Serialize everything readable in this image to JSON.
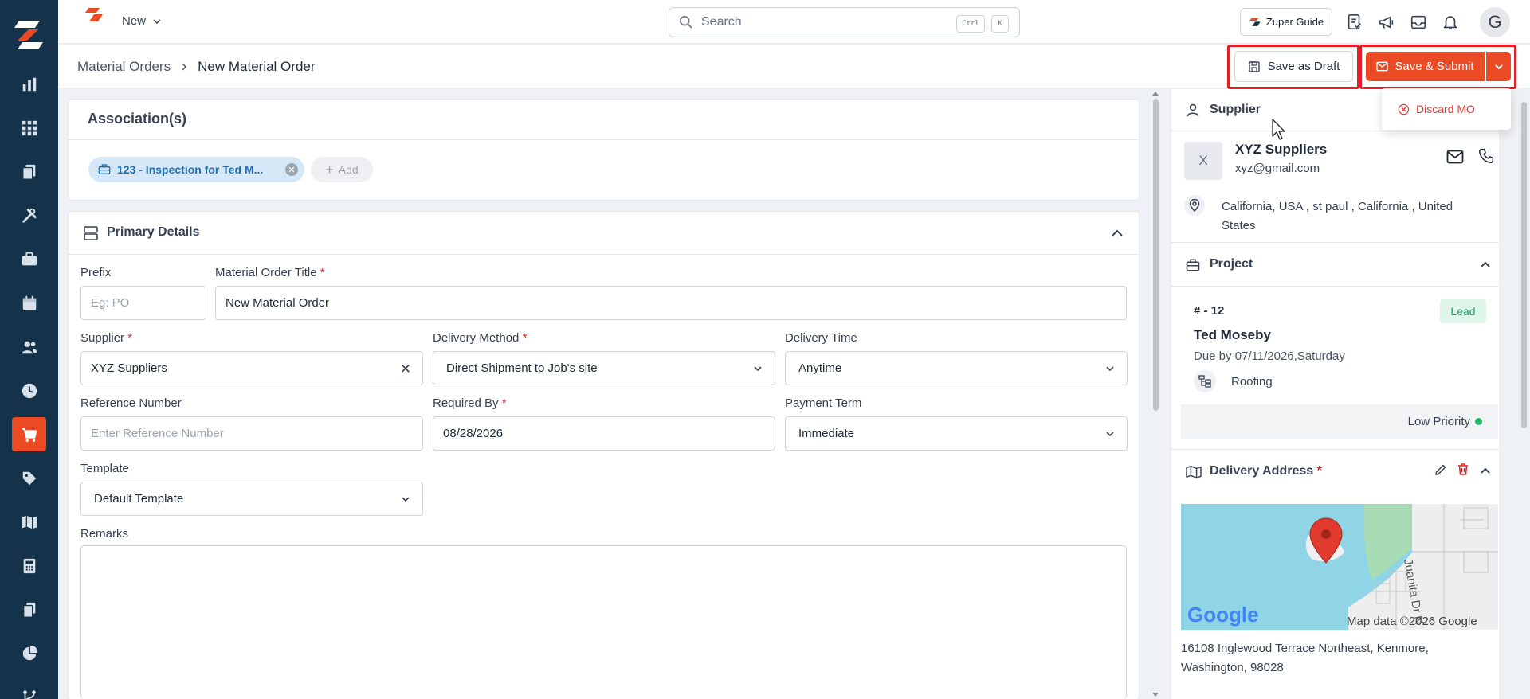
{
  "topbar": {
    "new_label": "New",
    "search_placeholder": "Search",
    "shortcut_key1": "Ctrl",
    "shortcut_key2": "K",
    "guide_label": "Zuper Guide",
    "avatar_initial": "G"
  },
  "breadcrumb": {
    "parent": "Material Orders",
    "current": "New Material Order"
  },
  "actions": {
    "save_draft": "Save as Draft",
    "save_submit": "Save & Submit",
    "discard": "Discard MO"
  },
  "associations": {
    "title": "Association(s)",
    "chip_label": "123 - Inspection for Ted M...",
    "add_label": "Add"
  },
  "primary": {
    "title": "Primary Details",
    "prefix_label": "Prefix",
    "prefix_placeholder": "Eg: PO",
    "title_label": "Material Order Title",
    "title_value": "New Material Order",
    "supplier_label": "Supplier",
    "supplier_value": "XYZ Suppliers",
    "delivery_method_label": "Delivery Method",
    "delivery_method_value": "Direct Shipment to Job's site",
    "delivery_time_label": "Delivery Time",
    "delivery_time_value": "Anytime",
    "reference_label": "Reference Number",
    "reference_placeholder": "Enter Reference Number",
    "required_by_label": "Required By",
    "required_by_value": "08/28/2026",
    "payment_term_label": "Payment Term",
    "payment_term_value": "Immediate",
    "template_label": "Template",
    "template_value": "Default Template",
    "remarks_label": "Remarks",
    "required_mark": "*"
  },
  "supplier_panel": {
    "title": "Supplier",
    "avatar": "X",
    "name": "XYZ Suppliers",
    "email": "xyz@gmail.com",
    "address_line1": "California, USA , st paul , California , United",
    "address_line2": "States"
  },
  "project_panel": {
    "title": "Project",
    "number": "# - 12",
    "badge": "Lead",
    "customer": "Ted Moseby",
    "due": "Due by 07/11/2026,Saturday",
    "category": "Roofing",
    "priority": "Low Priority"
  },
  "delivery_panel": {
    "title": "Delivery Address",
    "required_mark": "*",
    "map_logo": "Google",
    "map_credit": "Map data ©2026 Google",
    "map_street": "Juanita Dr N",
    "address_line1": "16108 Inglewood Terrace Northeast, Kenmore,",
    "address_line2": "Washington, 98028"
  },
  "colors": {
    "sidebar_bg": "#14334a",
    "accent": "#ea4b25",
    "highlight": "#e31f26",
    "chip_bg": "#d6e8f7",
    "lead_green": "#1fa864"
  }
}
